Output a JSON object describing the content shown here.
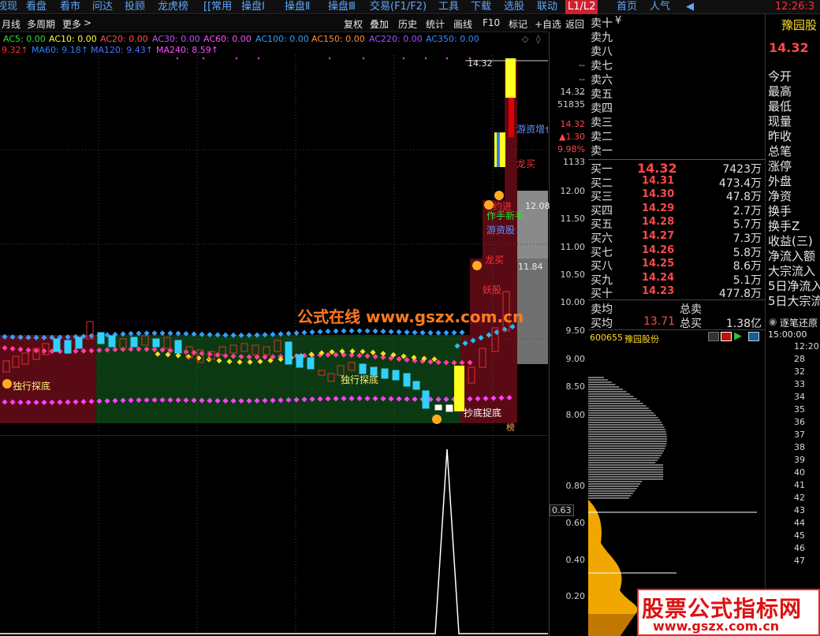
{
  "topbar": {
    "menu": [
      "视现",
      "看盘",
      "看市",
      "问达",
      "投顾",
      "龙虎榜",
      "[[常用",
      "操盘Ⅰ",
      "操盘Ⅱ",
      "操盘Ⅲ",
      "交易(F1/F2)",
      "工具",
      "下载",
      "选股",
      "联动"
    ],
    "active_tab": "L1/L2",
    "extra": [
      "首页",
      "人气"
    ],
    "time": "12:26:3"
  },
  "toolbar": {
    "period": "月线",
    "multi_period": "多周期",
    "more": "更多",
    "right_buttons": [
      "复权",
      "叠加",
      "历史",
      "统计",
      "画线",
      "F10",
      "标记",
      "+自选",
      "返回"
    ]
  },
  "indicators": {
    "row1": [
      {
        "label": "AC5: 0.00",
        "color": "#30e030"
      },
      {
        "label": "AC10: 0.00",
        "color": "#ffff30"
      },
      {
        "label": "AC20: 0.00",
        "color": "#ff5050"
      },
      {
        "label": "AC30: 0.00",
        "color": "#c050ff"
      },
      {
        "label": "AC60: 0.00",
        "color": "#ff50ff"
      },
      {
        "label": "AC100: 0.00",
        "color": "#30a0ff"
      },
      {
        "label": "AC150: 0.00",
        "color": "#ff9030"
      },
      {
        "label": "AC220: 0.00",
        "color": "#a050ff"
      },
      {
        "label": "AC350: 0.00",
        "color": "#3090ff"
      }
    ],
    "row2": [
      {
        "label": "9.32↑",
        "color": "#ff3030"
      },
      {
        "label": "MA60: 9.18↑",
        "color": "#3080ff"
      },
      {
        "label": "MA120: 9.43↑",
        "color": "#5070ff"
      },
      {
        "label": "MA240: 8.59↑",
        "color": "#ff50ff"
      }
    ]
  },
  "chart_annotations": {
    "watermark": "公式在线  www.gszx.com.cn",
    "signal_bottom": "独行探底",
    "signal_bottom2": "独行探底",
    "signal_dragon": "龙买",
    "signal_yao": "妖股",
    "signal_hot": "游资增仓",
    "signal_player": "作手新手",
    "signal_hot2": "游资股",
    "signal_top": "约进",
    "signal_end": "抄底捉底",
    "signal_wei": "榜",
    "high_price_tag": "14.32"
  },
  "price_axis": {
    "labels": [
      "14.32",
      "51835",
      "14.32",
      "▲1.30",
      "9.98%",
      "1133",
      "12.00",
      "11.50",
      "11.00",
      "10.50",
      "10.00",
      "9.50",
      "9.00",
      "8.50",
      "8.00"
    ],
    "dashes": [
      "--",
      "--",
      "--"
    ],
    "lower_labels": [
      "0.80",
      "0.63",
      "0.60",
      "0.40",
      "0.20"
    ],
    "marker_12": "12.08",
    "marker_11": "11.84"
  },
  "orderbook": {
    "asks": [
      {
        "label": "卖十",
        "price": "¥",
        "vol": ""
      },
      {
        "label": "卖九",
        "price": "",
        "vol": ""
      },
      {
        "label": "卖八",
        "price": "",
        "vol": ""
      },
      {
        "label": "卖七",
        "price": "",
        "vol": ""
      },
      {
        "label": "卖六",
        "price": "",
        "vol": ""
      },
      {
        "label": "卖五",
        "price": "",
        "vol": ""
      },
      {
        "label": "卖四",
        "price": "",
        "vol": ""
      },
      {
        "label": "卖三",
        "price": "",
        "vol": ""
      },
      {
        "label": "卖二",
        "price": "",
        "vol": ""
      },
      {
        "label": "卖一",
        "price": "",
        "vol": ""
      }
    ],
    "bids": [
      {
        "label": "买一",
        "price": "14.32",
        "vol": "7423万"
      },
      {
        "label": "买二",
        "price": "14.31",
        "vol": "473.4万"
      },
      {
        "label": "买三",
        "price": "14.30",
        "vol": "47.8万"
      },
      {
        "label": "买四",
        "price": "14.29",
        "vol": "2.7万"
      },
      {
        "label": "买五",
        "price": "14.28",
        "vol": "5.7万"
      },
      {
        "label": "买六",
        "price": "14.27",
        "vol": "7.3万"
      },
      {
        "label": "买七",
        "price": "14.26",
        "vol": "5.8万"
      },
      {
        "label": "买八",
        "price": "14.25",
        "vol": "8.6万"
      },
      {
        "label": "买九",
        "price": "14.24",
        "vol": "5.1万"
      },
      {
        "label": "买十",
        "price": "14.23",
        "vol": "477.8万"
      }
    ],
    "ask_avg_label": "卖均",
    "bid_avg_label": "买均",
    "bid_avg_price": "13.71",
    "total_sell_label": "总卖",
    "total_buy_label": "总买",
    "total_buy_value": "1.38亿"
  },
  "stockinfo": {
    "name": "豫园股",
    "price": "14.32",
    "labels": [
      "今开",
      "最高",
      "最低",
      "现量",
      "昨收",
      "总笔",
      "涨停",
      "外盘",
      "净资",
      "换手",
      "换手Z",
      "收益(三)",
      "净流入额",
      "大宗流入",
      "5日净流入",
      "5日大宗流"
    ]
  },
  "distribution": {
    "code": "600655",
    "name": "豫园股份"
  },
  "ticks": {
    "title": "逐笔还原",
    "start": "15:00:00",
    "times": [
      "12:20",
      "28",
      "32",
      "33",
      "34",
      "35",
      "36",
      "37",
      "38",
      "39",
      "40",
      "41",
      "42",
      "43",
      "44",
      "45",
      "46",
      "47"
    ]
  },
  "brand_watermark": {
    "title": "股票公式指标网",
    "url": "www.gszx.com.cn"
  }
}
